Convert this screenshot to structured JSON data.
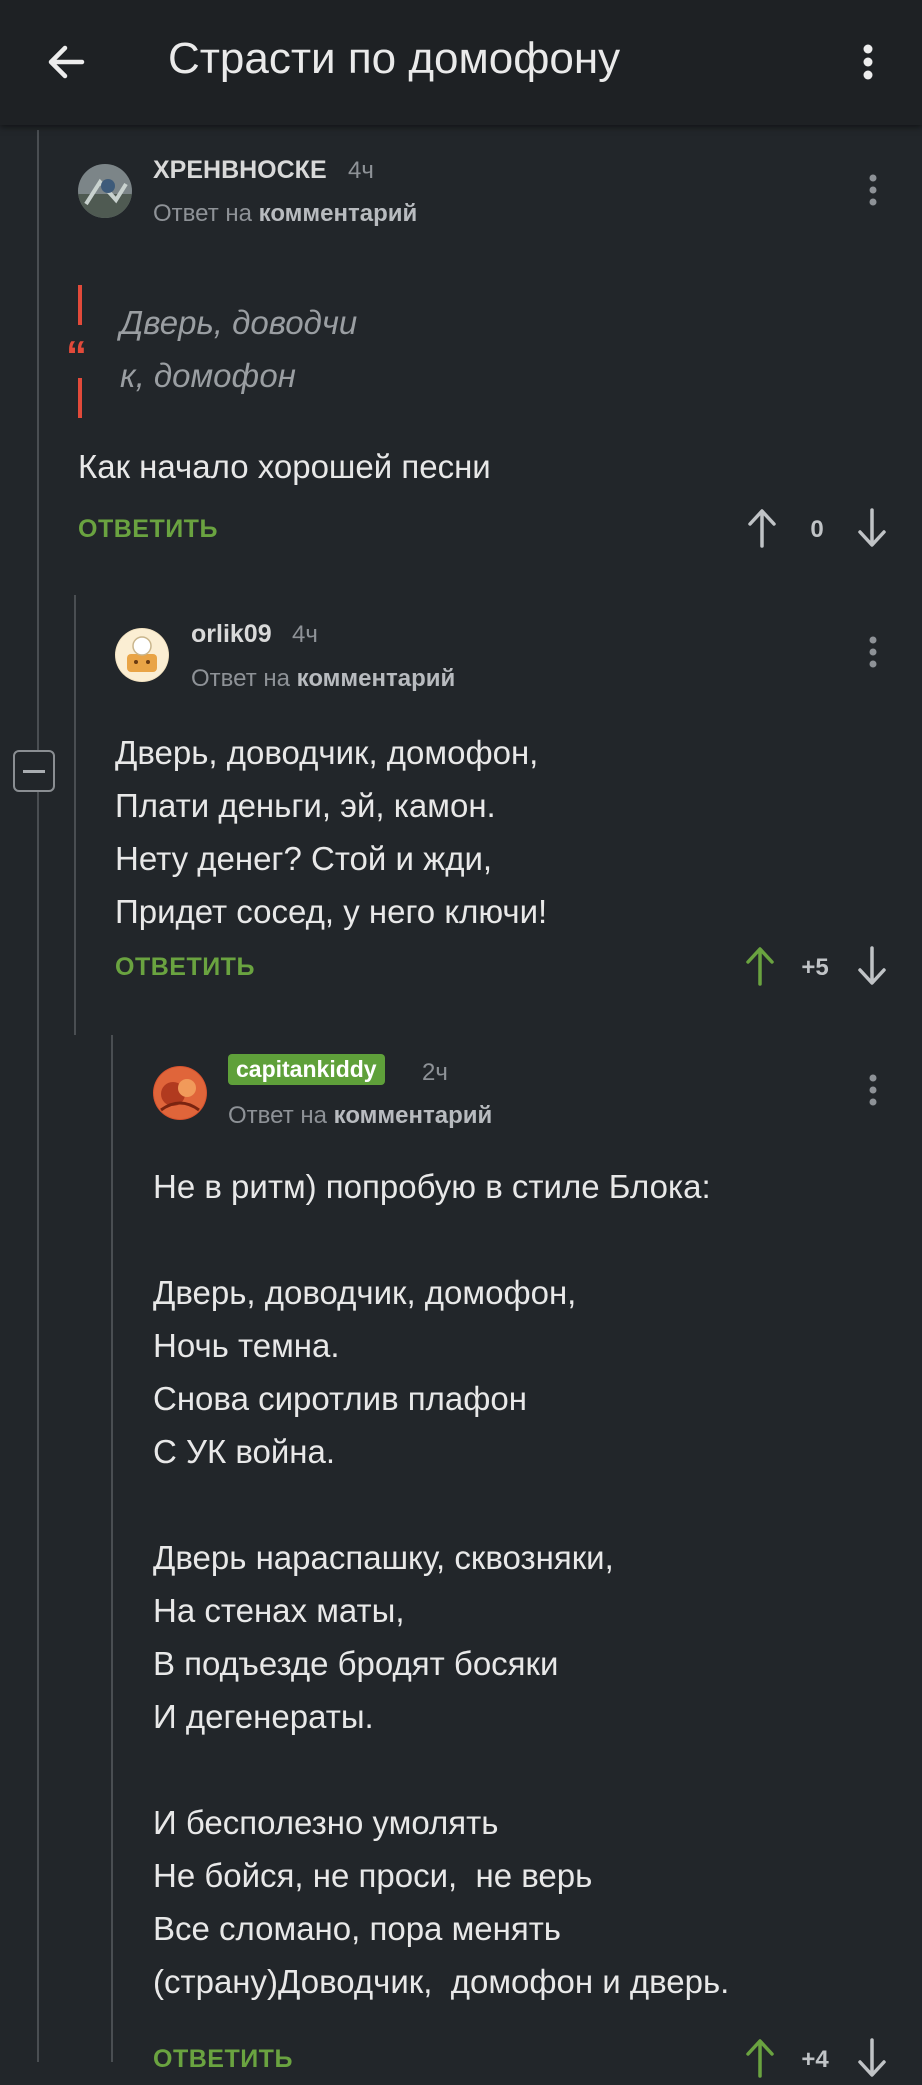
{
  "appbar": {
    "title": "Страсти по домофону"
  },
  "comments": [
    {
      "username": "ХРЕНВНОСКЕ",
      "time": "4ч",
      "reply_prefix": "Ответ на",
      "reply_target": "комментарий",
      "quote_lines": "Дверь, доводчи\nк, домофон",
      "body": "Как начало хорошей песни",
      "reply_label": "ОТВЕТИТЬ",
      "score": "0",
      "upvote_color": "#c0c3c6"
    },
    {
      "username": "orlik09",
      "time": "4ч",
      "reply_prefix": "Ответ на",
      "reply_target": "комментарий",
      "body": "Дверь, доводчик, домофон,\nПлати деньги, эй, камон.\nНету денег? Стой и жди,\nПридет сосед, у него ключи!",
      "reply_label": "ОТВЕТИТЬ",
      "score": "+5",
      "upvote_color": "#6aa340"
    },
    {
      "username": "capitankiddy",
      "time": "2ч",
      "reply_prefix": "Ответ на",
      "reply_target": "комментарий",
      "body": "Не в ритм) попробую в стиле Блока:\n\nДверь, доводчик, домофон,\nНочь темна.\nСнова сиротлив плафон\nС УК война.\n\nДверь нараспашку, сквозняки,\nНа стенах маты,\nВ подъезде бродят босяки\nИ дегенераты.\n\nИ бесполезно умолять\nНе бойся, не проси,  не верь\nВсе сломано, пора менять\n(страну)Доводчик,  домофон и дверь.",
      "reply_label": "ОТВЕТИТЬ",
      "score": "+4",
      "upvote_color": "#6aa340"
    }
  ],
  "colors": {
    "background": "#22262a",
    "appbar": "#1e2124",
    "accent_green": "#6aa340",
    "quote_red": "#e24a3a"
  },
  "icons": [
    "back-arrow-icon",
    "more-vertical-icon",
    "kebab-icon",
    "arrow-up-icon",
    "arrow-down-icon",
    "quote-icon",
    "collapse-icon"
  ]
}
